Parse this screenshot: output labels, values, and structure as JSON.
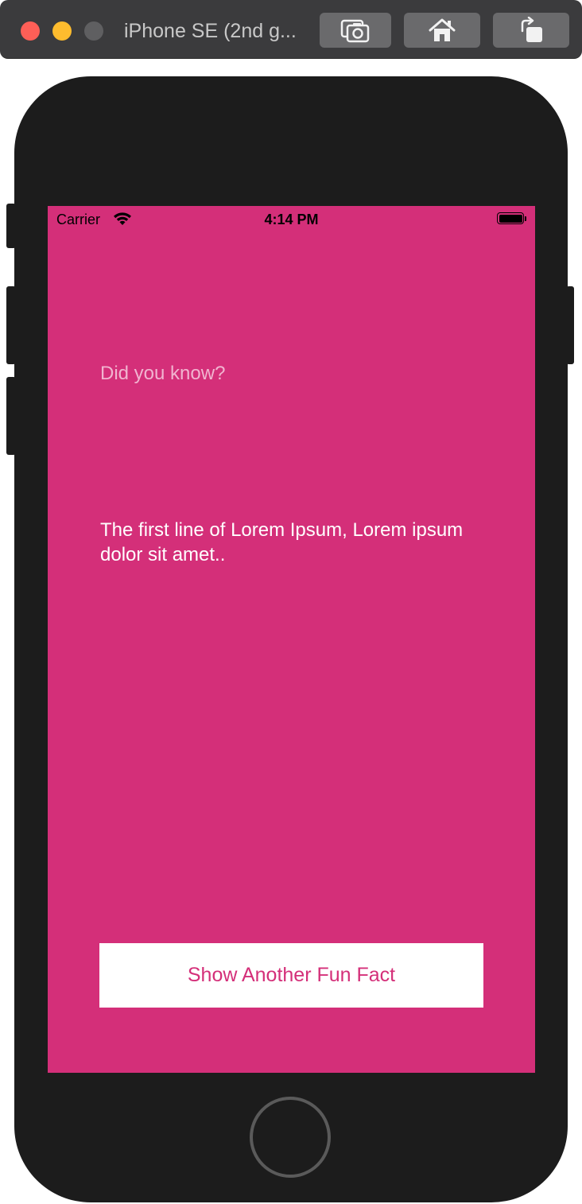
{
  "window": {
    "title": "iPhone SE (2nd g...",
    "buttons": [
      {
        "icon": "screenshot-camera-icon"
      },
      {
        "icon": "home-icon"
      },
      {
        "icon": "rotate-icon"
      }
    ]
  },
  "status_bar": {
    "carrier": "Carrier",
    "time": "4:14 PM",
    "battery_level": 1.0
  },
  "app": {
    "heading": "Did you know?",
    "fact": "The first line of Lorem Ipsum, Lorem ipsum dolor sit amet..",
    "button_label": "Show Another Fun Fact"
  },
  "colors": {
    "screen_background": "#d42f79",
    "button_text": "#d42f79",
    "heading_text": "#f1b4d0",
    "fact_text": "#ffffff",
    "device_body": "#1c1c1c"
  }
}
